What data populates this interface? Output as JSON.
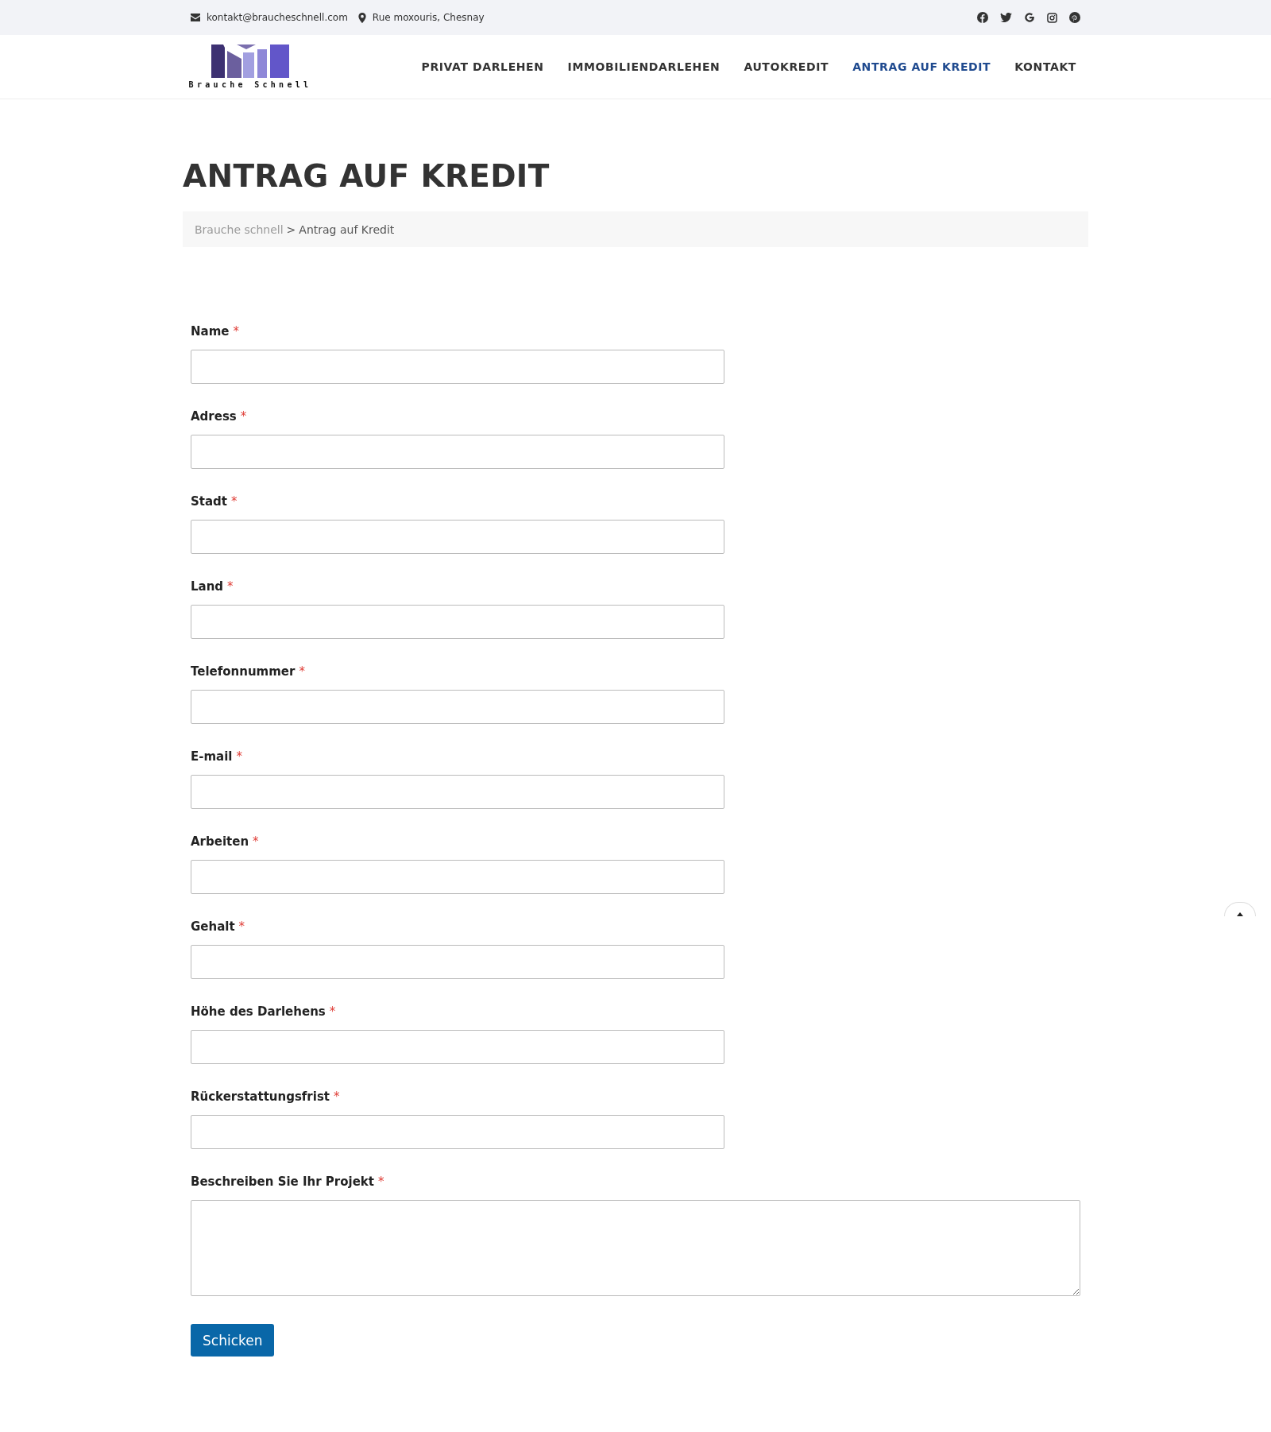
{
  "topbar": {
    "email": "kontakt@braucheschnell.com",
    "address": "Rue moxouris, Chesnay"
  },
  "logo": {
    "text": "Brauche Schnell"
  },
  "nav": [
    {
      "label": "PRIVAT DARLEHEN",
      "selected": false
    },
    {
      "label": "IMMOBILIENDARLEHEN",
      "selected": false
    },
    {
      "label": "AUTOKREDIT",
      "selected": false
    },
    {
      "label": "ANTRAG AUF KREDIT",
      "selected": true
    },
    {
      "label": "KONTAKT",
      "selected": false
    }
  ],
  "page_title": "ANTRAG AUF KREDIT",
  "breadcrumb": {
    "home": "Brauche schnell",
    "separator": ">",
    "current": "Antrag auf Kredit"
  },
  "form": {
    "fields": [
      {
        "label": "Name",
        "required": true,
        "kind": "input"
      },
      {
        "label": "Adress",
        "required": true,
        "kind": "input"
      },
      {
        "label": "Stadt",
        "required": true,
        "kind": "input"
      },
      {
        "label": "Land",
        "required": true,
        "kind": "input"
      },
      {
        "label": "Telefonnummer",
        "required": true,
        "kind": "input"
      },
      {
        "label": "E-mail",
        "required": true,
        "kind": "input"
      },
      {
        "label": "Arbeiten",
        "required": true,
        "kind": "input"
      },
      {
        "label": "Gehalt",
        "required": true,
        "kind": "input"
      },
      {
        "label": "Höhe des Darlehens",
        "required": true,
        "kind": "input"
      },
      {
        "label": "Rückerstattungsfrist",
        "required": true,
        "kind": "input"
      },
      {
        "label": "Beschreiben Sie Ihr Projekt",
        "required": true,
        "kind": "textarea"
      }
    ],
    "required_mark": "*",
    "submit": "Schicken"
  }
}
